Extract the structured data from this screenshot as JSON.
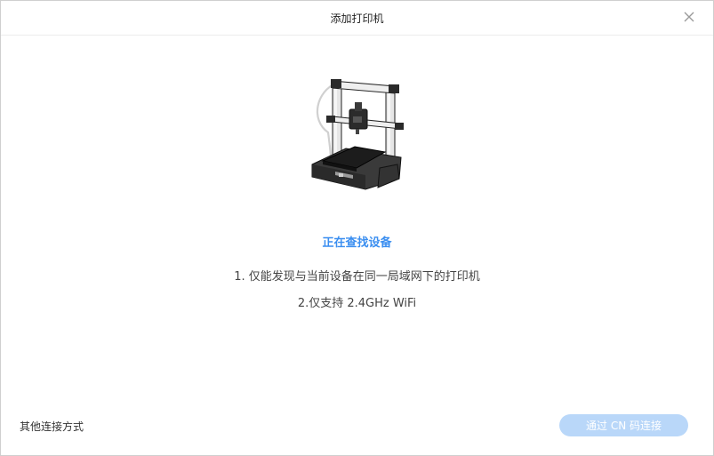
{
  "dialog": {
    "title": "添加打印机",
    "status": "正在查找设备",
    "notes": [
      "1. 仅能发现与当前设备在同一局域网下的打印机",
      "2.仅支持 2.4GHz WiFi"
    ],
    "other_connection": "其他连接方式",
    "cn_code_button": "通过 CN 码连接"
  },
  "icons": {
    "close": "close-icon",
    "printer": "3d-printer-illustration"
  },
  "colors": {
    "status_text": "#3a8ef0",
    "primary_button_disabled": "#b9d7f9"
  }
}
